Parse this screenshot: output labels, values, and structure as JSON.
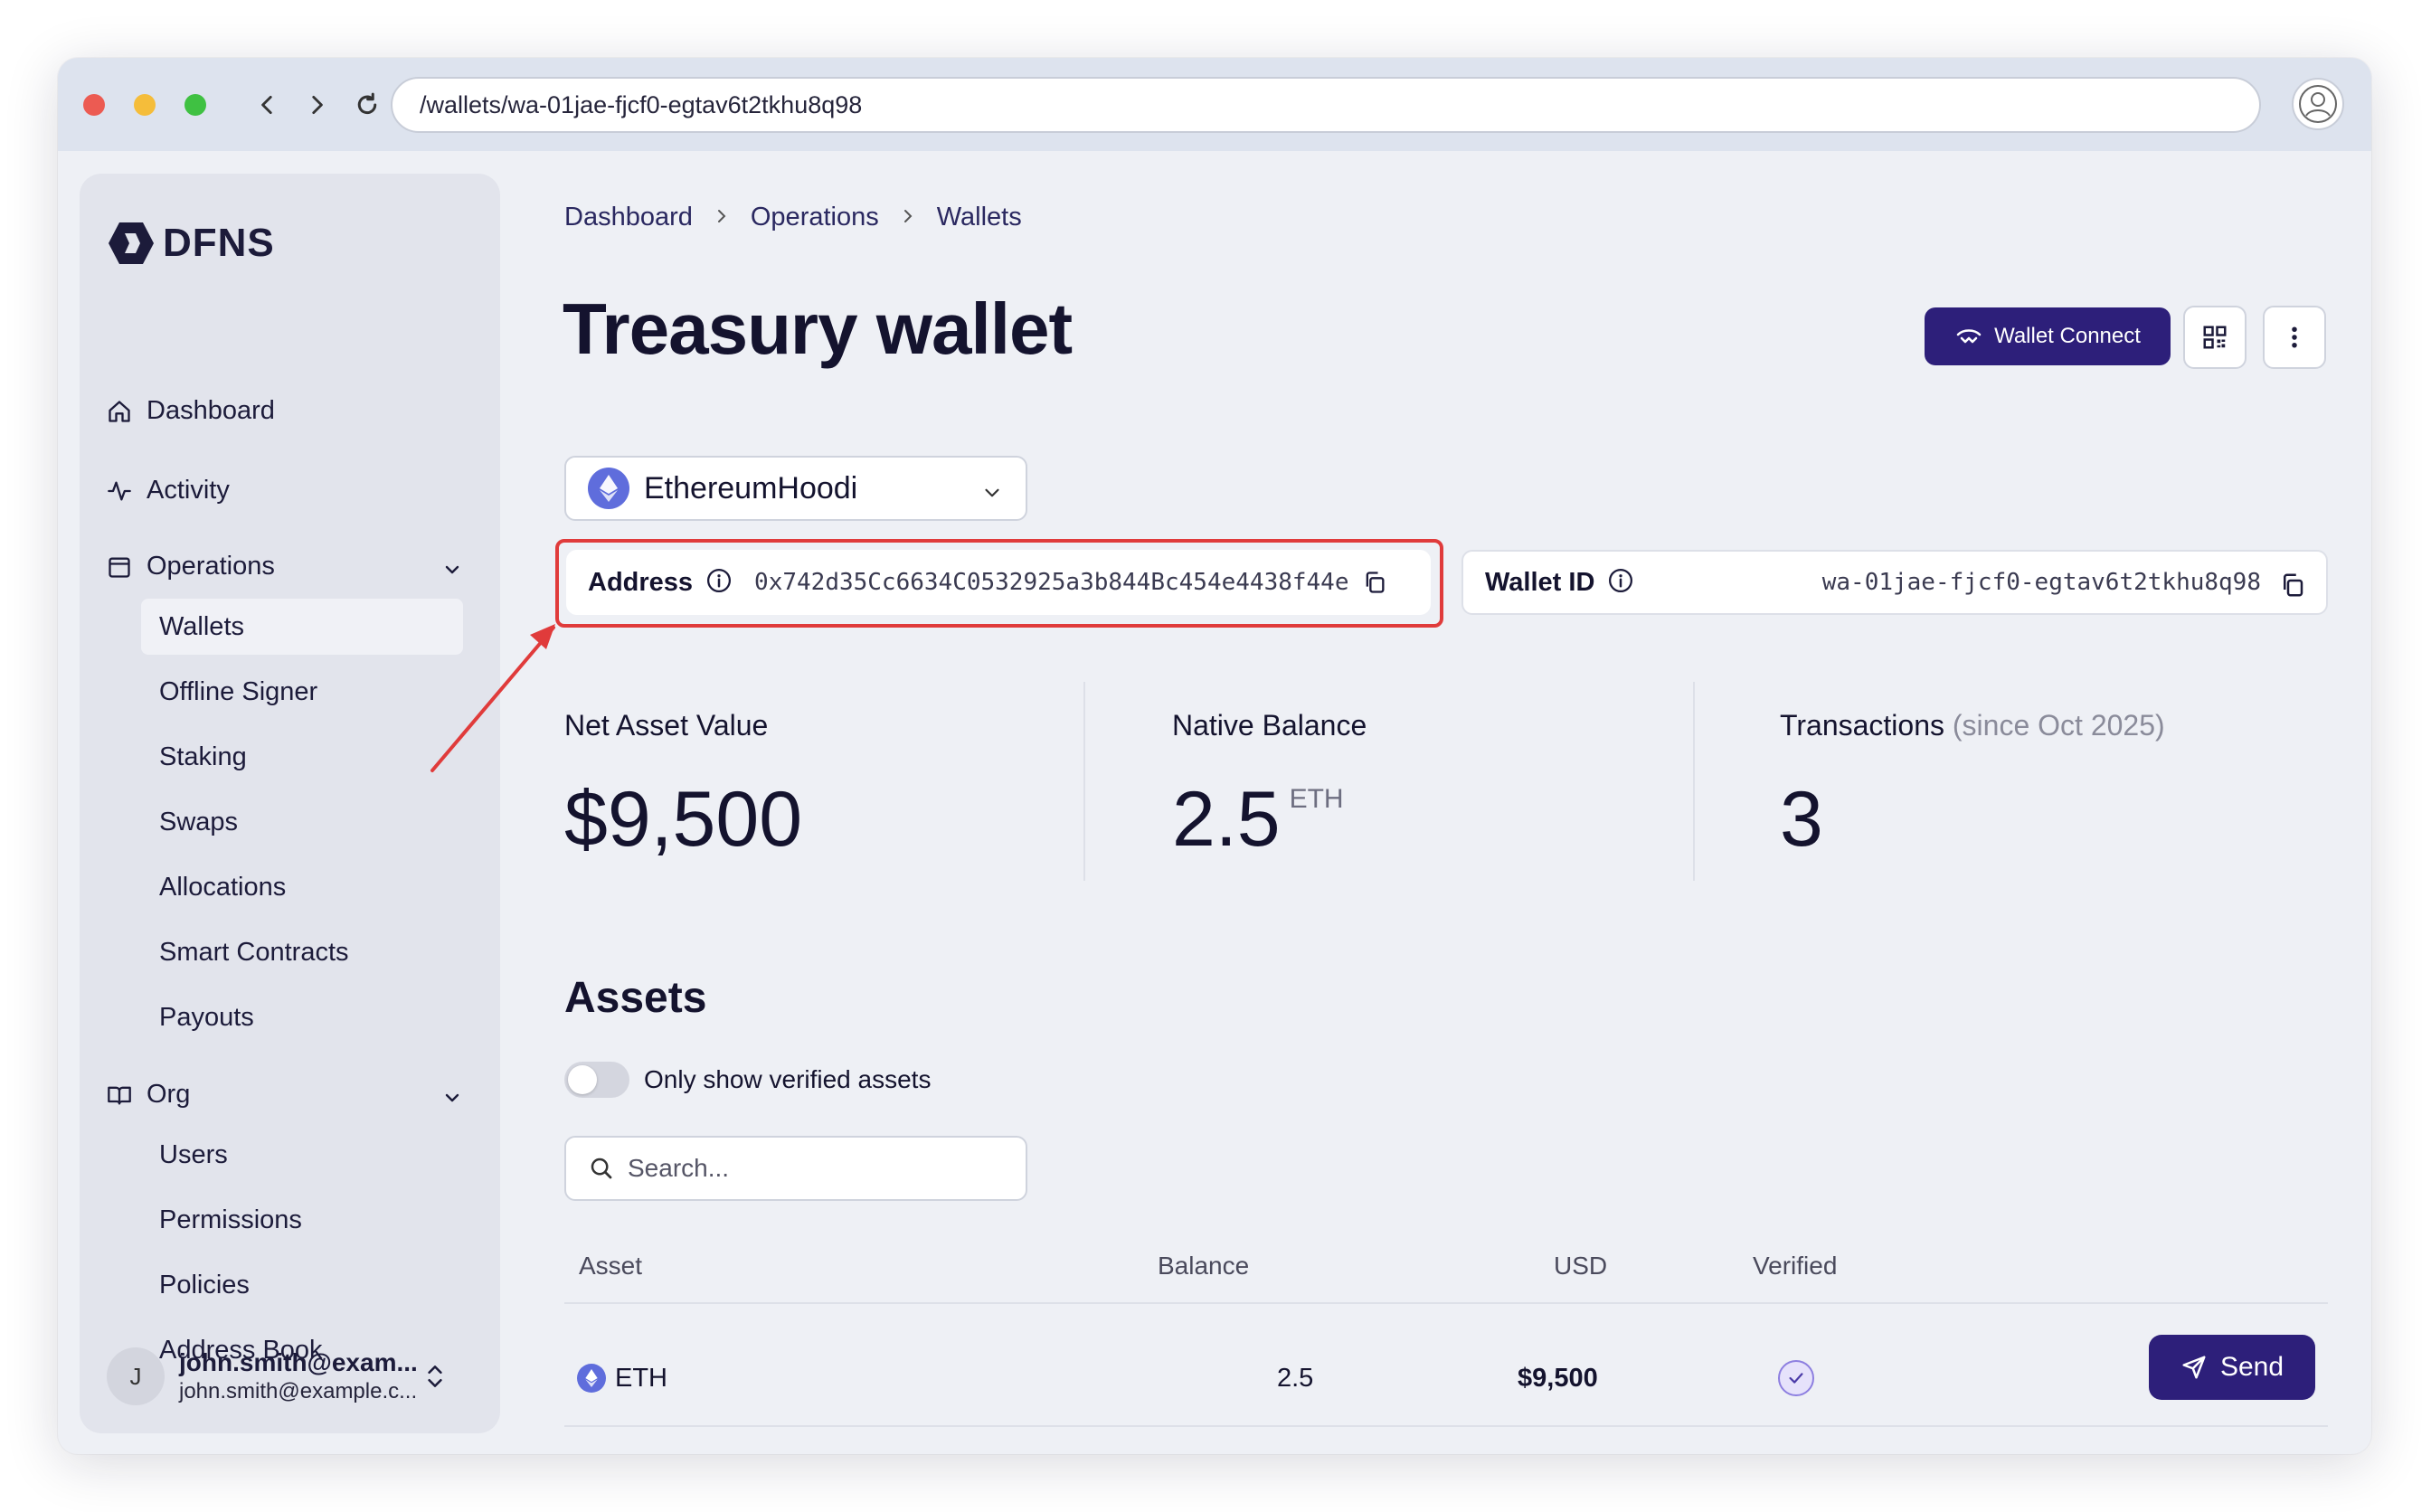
{
  "browser": {
    "url": "/wallets/wa-01jae-fjcf0-egtav6t2tkhu8q98"
  },
  "sidebar": {
    "logo": "DFNS",
    "items": [
      {
        "label": "Dashboard",
        "icon": "home-icon"
      },
      {
        "label": "Activity",
        "icon": "activity-icon"
      },
      {
        "label": "Operations",
        "icon": "folder-icon"
      }
    ],
    "operations_items": [
      "Wallets",
      "Offline Signer",
      "Staking",
      "Swaps",
      "Allocations",
      "Smart Contracts",
      "Payouts"
    ],
    "org_label": "Org",
    "org_items": [
      "Users",
      "Permissions",
      "Policies",
      "Address Book"
    ],
    "active_item": "Wallets",
    "user": {
      "initial": "J",
      "name": "john.smith@exam...",
      "email": "john.smith@example.c..."
    }
  },
  "breadcrumb": [
    "Dashboard",
    "Operations",
    "Wallets"
  ],
  "page_title": "Treasury wallet",
  "toolbar": {
    "wallet_connect_label": "Wallet Connect"
  },
  "network": {
    "name": "EthereumHoodi"
  },
  "address": {
    "label": "Address",
    "value": "0x742d35Cc6634C0532925a3b844Bc454e4438f44e"
  },
  "wallet_id": {
    "label": "Wallet ID",
    "value": "wa-01jae-fjcf0-egtav6t2tkhu8q98"
  },
  "stats": {
    "net_asset_value_label": "Net Asset Value",
    "net_asset_value": "$9,500",
    "native_balance_label": "Native Balance",
    "native_balance": "2.5",
    "native_unit": "ETH",
    "transactions_label": "Transactions",
    "transactions_since": "(since Oct 2025)",
    "transactions": "3"
  },
  "assets": {
    "title": "Assets",
    "toggle_label": "Only show verified assets",
    "toggle_on": false,
    "search_placeholder": "Search...",
    "columns": [
      "Asset",
      "Balance",
      "USD",
      "Verified"
    ],
    "rows": [
      {
        "asset": "ETH",
        "balance": "2.5",
        "usd": "$9,500",
        "verified": true,
        "action": "Send"
      }
    ]
  },
  "colors": {
    "accent": "#2d1f7a",
    "highlight": "#e03b3b",
    "eth": "#5f6ddc"
  }
}
